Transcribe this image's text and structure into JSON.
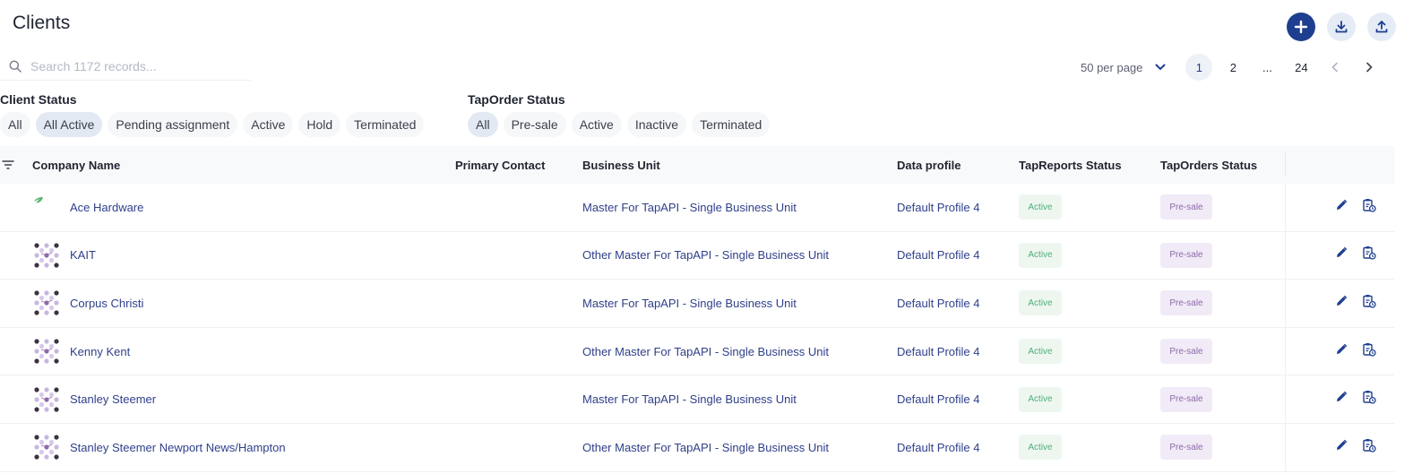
{
  "header": {
    "title": "Clients",
    "add_icon": "plus-icon",
    "download_icon": "download-icon",
    "upload_icon": "upload-icon"
  },
  "search": {
    "placeholder": "Search 1172 records...",
    "value": ""
  },
  "pagination": {
    "per_page": "50 per page",
    "pages": [
      "1",
      "2",
      "...",
      "24"
    ],
    "current": "1",
    "prev_icon": "chevron-left-icon",
    "next_icon": "chevron-right-icon"
  },
  "client_status": {
    "label": "Client Status",
    "options": [
      "All",
      "All Active",
      "Pending assignment",
      "Active",
      "Hold",
      "Terminated"
    ],
    "selected": "All Active"
  },
  "taporder_status": {
    "label": "TapOrder Status",
    "options": [
      "All",
      "Pre-sale",
      "Active",
      "Inactive",
      "Terminated"
    ],
    "selected": "All"
  },
  "table": {
    "columns": [
      "Company Name",
      "Primary Contact",
      "Business Unit",
      "Data profile",
      "TapReports Status",
      "TapOrders Status"
    ],
    "rows": [
      {
        "company": "Ace Hardware",
        "contact": "",
        "business_unit": "Master For TapAPI - Single Business Unit",
        "profile": "Default Profile 4",
        "tapreports": "Active",
        "taporders": "Pre-sale",
        "logo": "leaf-logo"
      },
      {
        "company": "KAIT",
        "contact": "",
        "business_unit": "Other Master For TapAPI - Single Business Unit",
        "profile": "Default Profile 4",
        "tapreports": "Active",
        "taporders": "Pre-sale",
        "logo": "dots-logo"
      },
      {
        "company": "Corpus Christi",
        "contact": "",
        "business_unit": "Master For TapAPI - Single Business Unit",
        "profile": "Default Profile 4",
        "tapreports": "Active",
        "taporders": "Pre-sale",
        "logo": "dots-logo"
      },
      {
        "company": "Kenny Kent",
        "contact": "",
        "business_unit": "Other Master For TapAPI - Single Business Unit",
        "profile": "Default Profile 4",
        "tapreports": "Active",
        "taporders": "Pre-sale",
        "logo": "dots-logo"
      },
      {
        "company": "Stanley Steemer",
        "contact": "",
        "business_unit": "Master For TapAPI - Single Business Unit",
        "profile": "Default Profile 4",
        "tapreports": "Active",
        "taporders": "Pre-sale",
        "logo": "dots-logo"
      },
      {
        "company": "Stanley Steemer Newport News/Hampton",
        "contact": "",
        "business_unit": "Other Master For TapAPI - Single Business Unit",
        "profile": "Default Profile 4",
        "tapreports": "Active",
        "taporders": "Pre-sale",
        "logo": "dots-logo"
      }
    ]
  },
  "colors": {
    "primary": "#1e3f8f",
    "link": "#2f3f8a",
    "active_badge_bg": "#eef7ef",
    "active_badge_text": "#4caf7a",
    "presale_badge_bg": "#f1eaf7",
    "presale_badge_text": "#8f6aa8"
  }
}
